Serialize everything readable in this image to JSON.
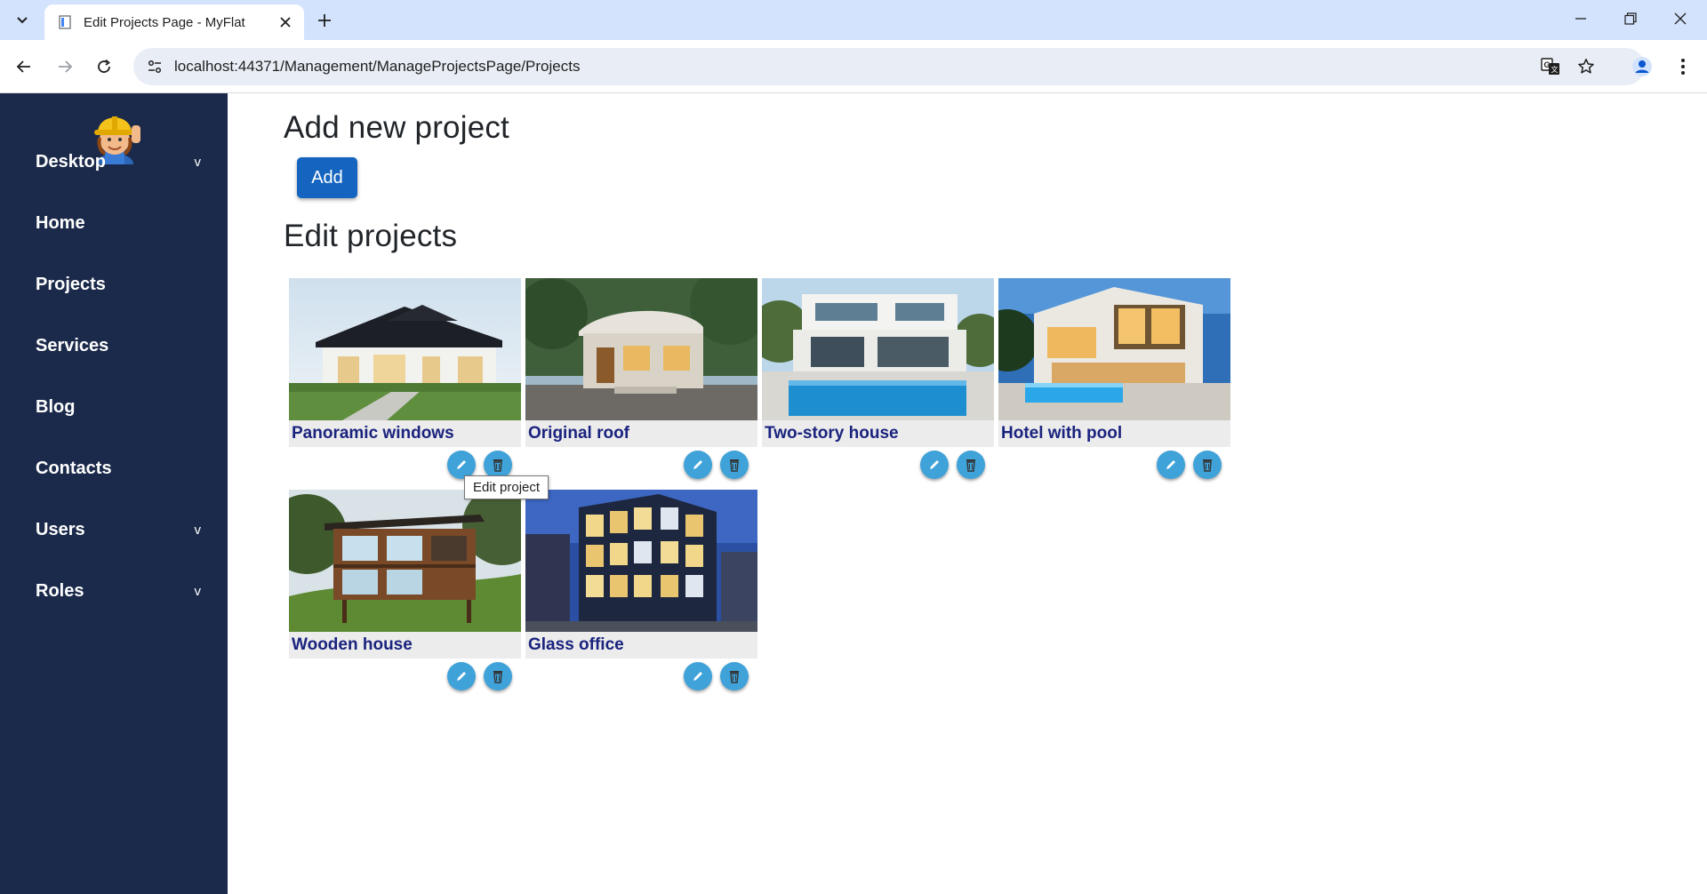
{
  "browser": {
    "tab_title": "Edit Projects Page - MyFlat",
    "url": "localhost:44371/Management/ManageProjectsPage/Projects"
  },
  "sidebar": {
    "items": [
      {
        "label": "Desktop",
        "caret": "v"
      },
      {
        "label": "Home",
        "caret": ""
      },
      {
        "label": "Projects",
        "caret": ""
      },
      {
        "label": "Services",
        "caret": ""
      },
      {
        "label": "Blog",
        "caret": ""
      },
      {
        "label": "Contacts",
        "caret": ""
      },
      {
        "label": "Users",
        "caret": "v"
      },
      {
        "label": "Roles",
        "caret": "v"
      }
    ]
  },
  "main": {
    "add_heading": "Add new project",
    "add_button": "Add",
    "edit_heading": "Edit projects",
    "projects": [
      {
        "title": "Panoramic windows"
      },
      {
        "title": "Original roof"
      },
      {
        "title": "Two-story house"
      },
      {
        "title": "Hotel with pool"
      },
      {
        "title": "Wooden house"
      },
      {
        "title": "Glass office"
      }
    ],
    "tooltip": "Edit project"
  },
  "colors": {
    "sidebar_bg": "#1b2a4a",
    "accent_button": "#1565c0",
    "action_circle": "#3fa2d9",
    "caption_text": "#1a237e",
    "chrome_tabbar": "#d3e3fd"
  }
}
